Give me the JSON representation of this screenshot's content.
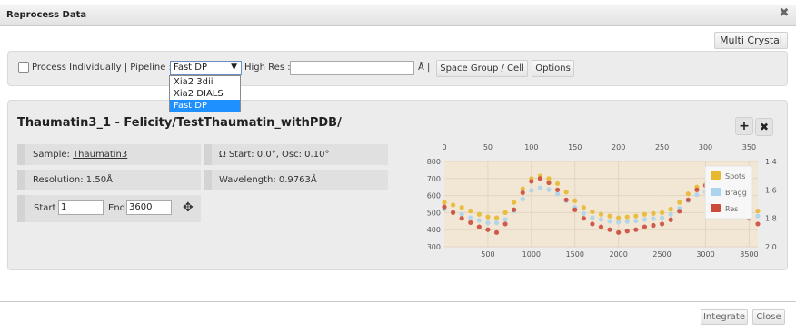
{
  "dialog": {
    "title": "Reprocess Data"
  },
  "multi_crystal_label": "Multi Crystal",
  "toolbar": {
    "process_individually_label": "Process Individually | Pipeline :",
    "pipeline_selected": "Fast DP",
    "pipeline_options": [
      "Xia2 3dii",
      "Xia2 DIALS",
      "Fast DP"
    ],
    "high_res_label": "High Res :",
    "high_res_value": "",
    "angstrom_sep": "Å |",
    "space_group_label": "Space Group / Cell",
    "options_label": "Options"
  },
  "dataset": {
    "title": "Thaumatin3_1 - Felicity/TestThaumatin_withPDB/",
    "sample_label": "Sample:",
    "sample_value": "Thaumatin3",
    "omega_text": "Ω Start: 0.0°, Osc: 0.10°",
    "resolution_text": "Resolution: 1.50Å",
    "wavelength_text": "Wavelength: 0.9763Å",
    "start_label": "Start",
    "start_value": "1",
    "end_label": "End",
    "end_value": "3600"
  },
  "footer": {
    "integrate_label": "Integrate",
    "close_label": "Close"
  },
  "chart_data": {
    "type": "scatter",
    "x_bottom": {
      "ticks": [
        500,
        1000,
        1500,
        2000,
        2500,
        3000,
        3500
      ],
      "range": [
        0,
        3600
      ]
    },
    "x_top": {
      "ticks": [
        0,
        50,
        100,
        150,
        200,
        250,
        300,
        350
      ],
      "range": [
        0,
        360
      ]
    },
    "y_left": {
      "ticks": [
        800,
        700,
        600,
        500,
        400,
        300
      ],
      "range": [
        300,
        800
      ]
    },
    "y_right": {
      "ticks": [
        1.4,
        1.6,
        1.8,
        2.0
      ],
      "range": [
        1.4,
        2.0
      ],
      "inverted": true
    },
    "legend": {
      "placement": "top-right",
      "items": [
        "Spots",
        "Bragg",
        "Res"
      ]
    },
    "colors": {
      "Spots": "#e8b830",
      "Bragg": "#aad4ee",
      "Res": "#cc4a3c",
      "bg": "#f2e6d4"
    },
    "series": [
      {
        "name": "Spots",
        "x": [
          0,
          100,
          200,
          300,
          400,
          500,
          600,
          700,
          800,
          900,
          1000,
          1100,
          1200,
          1300,
          1400,
          1500,
          1600,
          1700,
          1800,
          1900,
          2000,
          2100,
          2200,
          2300,
          2400,
          2500,
          2600,
          2700,
          2800,
          2900,
          3000,
          3100,
          3200,
          3300,
          3400,
          3500,
          3600
        ],
        "y": [
          560,
          545,
          530,
          510,
          490,
          475,
          470,
          500,
          560,
          640,
          700,
          715,
          700,
          670,
          620,
          570,
          530,
          505,
          490,
          480,
          470,
          475,
          480,
          490,
          495,
          500,
          520,
          560,
          610,
          650,
          665,
          670,
          650,
          610,
          570,
          530,
          510
        ]
      },
      {
        "name": "Bragg",
        "x": [
          0,
          100,
          200,
          300,
          400,
          500,
          600,
          700,
          800,
          900,
          1000,
          1100,
          1200,
          1300,
          1400,
          1500,
          1600,
          1700,
          1800,
          1900,
          2000,
          2100,
          2200,
          2300,
          2400,
          2500,
          2600,
          2700,
          2800,
          2900,
          3000,
          3100,
          3200,
          3300,
          3400,
          3500,
          3600
        ],
        "y": [
          520,
          505,
          490,
          470,
          455,
          440,
          440,
          460,
          510,
          580,
          630,
          645,
          635,
          610,
          570,
          530,
          495,
          470,
          460,
          450,
          445,
          448,
          452,
          460,
          465,
          470,
          490,
          525,
          570,
          605,
          620,
          622,
          605,
          570,
          530,
          495,
          480
        ]
      },
      {
        "name": "Res",
        "x": [
          0,
          100,
          200,
          300,
          400,
          500,
          600,
          700,
          800,
          900,
          1000,
          1100,
          1200,
          1300,
          1400,
          1500,
          1600,
          1700,
          1800,
          1900,
          2000,
          2100,
          2200,
          2300,
          2400,
          2500,
          2600,
          2700,
          2800,
          2900,
          3000,
          3100,
          3200,
          3300,
          3400,
          3500,
          3600
        ],
        "y": [
          1.72,
          1.76,
          1.8,
          1.83,
          1.86,
          1.88,
          1.9,
          1.84,
          1.74,
          1.62,
          1.54,
          1.52,
          1.55,
          1.6,
          1.67,
          1.74,
          1.8,
          1.84,
          1.86,
          1.88,
          1.9,
          1.89,
          1.88,
          1.86,
          1.85,
          1.84,
          1.81,
          1.75,
          1.67,
          1.6,
          1.57,
          1.56,
          1.6,
          1.66,
          1.74,
          1.8,
          1.84
        ]
      }
    ]
  }
}
